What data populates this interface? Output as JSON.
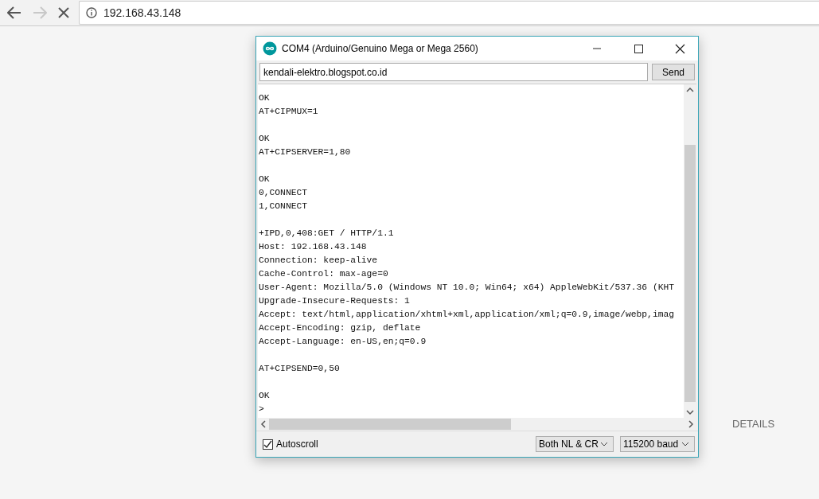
{
  "browser": {
    "address": "192.168.43.148",
    "forward_disabled": true
  },
  "page": {
    "details_link": "DETAILS"
  },
  "window": {
    "title": "COM4 (Arduino/Genuino Mega or Mega 2560)"
  },
  "send_bar": {
    "value": "kendali-elektro.blogspot.co.id",
    "button": "Send"
  },
  "output": [
    [
      "OK",
      "AT+CIPMUX=1"
    ],
    [
      "OK",
      "AT+CIPSERVER=1,80"
    ],
    [
      "OK",
      "0,CONNECT",
      "1,CONNECT"
    ],
    [
      "+IPD,0,408:GET / HTTP/1.1",
      "Host: 192.168.43.148",
      "Connection: keep-alive",
      "Cache-Control: max-age=0",
      "User-Agent: Mozilla/5.0 (Windows NT 10.0; Win64; x64) AppleWebKit/537.36 (KHT",
      "Upgrade-Insecure-Requests: 1",
      "Accept: text/html,application/xhtml+xml,application/xml;q=0.9,image/webp,imag",
      "Accept-Encoding: gzip, deflate",
      "Accept-Language: en-US,en;q=0.9"
    ],
    [
      "AT+CIPSEND=0,50"
    ],
    [
      "OK",
      ">"
    ]
  ],
  "footer": {
    "autoscroll": {
      "label": "Autoscroll",
      "checked": true
    },
    "line_ending": "Both NL & CR",
    "baud": "115200 baud"
  }
}
